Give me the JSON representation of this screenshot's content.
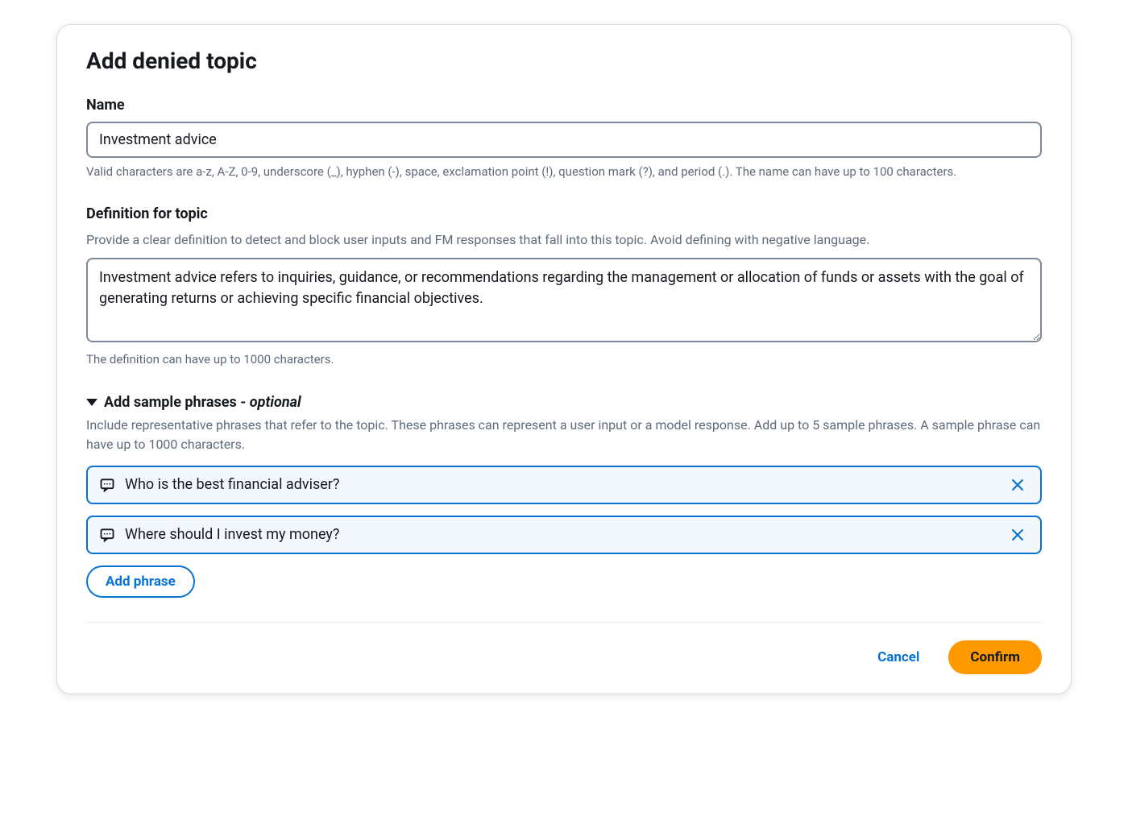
{
  "modal": {
    "title": "Add denied topic",
    "name": {
      "label": "Name",
      "value": "Investment advice",
      "help": "Valid characters are a-z, A-Z, 0-9, underscore (_), hyphen (-), space, exclamation point (!), question mark (?), and period (.). The name can have up to 100 characters."
    },
    "definition": {
      "label": "Definition for topic",
      "sublabel": "Provide a clear definition to detect and block user inputs and FM responses that fall into this topic. Avoid defining with negative language.",
      "value": "Investment advice refers to inquiries, guidance, or recommendations regarding the management or allocation of funds or assets with the goal of generating returns or achieving specific financial objectives.",
      "help": "The definition can have up to 1000 characters."
    },
    "samplePhrases": {
      "titlePrefix": "Add sample phrases - ",
      "optional": "optional",
      "sublabel": "Include representative phrases that refer to the topic. These phrases can represent a user input or a model response. Add up to 5 sample phrases. A sample phrase can have up to 1000 characters.",
      "phrases": [
        "Who is the best financial adviser?",
        "Where should I invest my money?"
      ],
      "addLabel": "Add phrase"
    },
    "footer": {
      "cancel": "Cancel",
      "confirm": "Confirm"
    }
  }
}
